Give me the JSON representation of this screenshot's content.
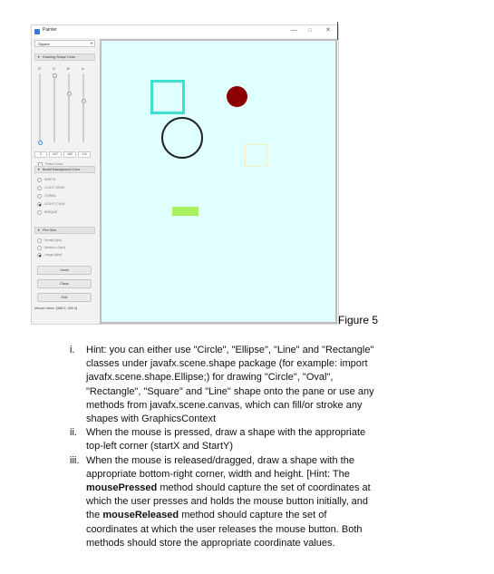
{
  "window": {
    "title": "Painter",
    "minimize_glyph": "—",
    "maximize_glyph": "□",
    "close_glyph": "✕"
  },
  "controls": {
    "shape_select": {
      "value": "Square",
      "arrow": "▾"
    },
    "drawing_color": {
      "header": "Drawing Shape Color",
      "channels": [
        {
          "label": "R",
          "value": "0",
          "level": 0.0
        },
        {
          "label": "G",
          "value": "247",
          "level": 0.97
        },
        {
          "label": "B",
          "value": "182",
          "level": 0.71
        },
        {
          "label": "A",
          "value": "0.6",
          "level": 0.6
        }
      ],
      "filled_label": "Filled Color",
      "filled": false
    },
    "background_color": {
      "header": "Board Background Color",
      "options": [
        {
          "label": "WHITE",
          "selected": false
        },
        {
          "label": "LIGHT GRAY",
          "selected": false
        },
        {
          "label": "CORAL",
          "selected": false
        },
        {
          "label": "LIGHT CYAN",
          "selected": true
        },
        {
          "label": "BISQUE",
          "selected": false
        }
      ]
    },
    "pen_size": {
      "header": "Pen Size",
      "options": [
        {
          "label": "Small (2px)",
          "selected": false
        },
        {
          "label": "Medium (4px)",
          "selected": false
        },
        {
          "label": "Large (6px)",
          "selected": true
        }
      ]
    },
    "buttons": {
      "undo": "Undo",
      "clear": "Clear",
      "exit": "Exit"
    },
    "mouse_status": "Mouse move: [488.0, 460.0]"
  },
  "canvas": {
    "background": "#e0ffff",
    "shape_colors": {
      "square_outline": "#40e0d0",
      "filled_circle": "#8b0000",
      "circle_outline": "#222222",
      "small_square_outline": "#f5f0c8",
      "filled_rectangle": "#a8f060"
    }
  },
  "figure_label": "Figure 5",
  "instructions": [
    {
      "num": "i.",
      "lines": [
        "Hint: you can either use \"Circle\", \"Ellipse\", \"Line\" and \"Rectangle\"",
        "classes under javafx.scene.shape package (for example: import",
        "javafx.scene.shape.Ellipse;) for drawing \"Circle\", \"Oval\",",
        "\"Rectangle\", \"Square\" and \"Line\" shape onto the pane or use any",
        "methods from javafx.scene.canvas, which can fill/or stroke any",
        "shapes with GraphicsContext"
      ]
    },
    {
      "num": "ii.",
      "lines": [
        "When the mouse is pressed, draw a shape with the appropriate",
        "top-left corner (startX and StartY)"
      ]
    },
    {
      "num": "iii.",
      "lines": [
        "When the mouse is released/dragged, draw a shape with the",
        "appropriate bottom-right corner, width and height. [Hint: The",
        "method should capture the set of coordinates at",
        "which the user presses and holds the mouse button initially, and",
        "the",
        "method should capture the set of",
        "coordinates at which the user releases the mouse button. Both",
        "methods should store the appropriate coordinate values."
      ],
      "bold_terms": [
        "mousePressed",
        "mouseReleased"
      ]
    }
  ]
}
